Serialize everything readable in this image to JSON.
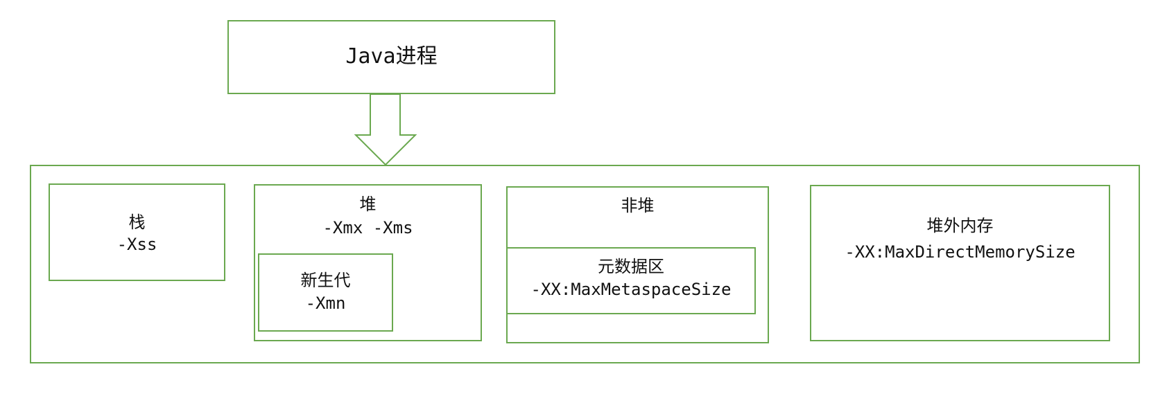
{
  "colors": {
    "stroke": "#6aa84f",
    "text": "#111111",
    "background": "#ffffff"
  },
  "process": {
    "title": "Java进程"
  },
  "stack": {
    "title": "栈",
    "flag": "-Xss"
  },
  "heap": {
    "title": "堆",
    "flag": "-Xmx -Xms",
    "young_gen": {
      "title": "新生代",
      "flag": "-Xmn"
    }
  },
  "non_heap": {
    "title": "非堆",
    "metaspace": {
      "title": "元数据区",
      "flag": "-XX:MaxMetaspaceSize"
    }
  },
  "off_heap": {
    "title": "堆外内存",
    "flag": "-XX:MaxDirectMemorySize"
  }
}
